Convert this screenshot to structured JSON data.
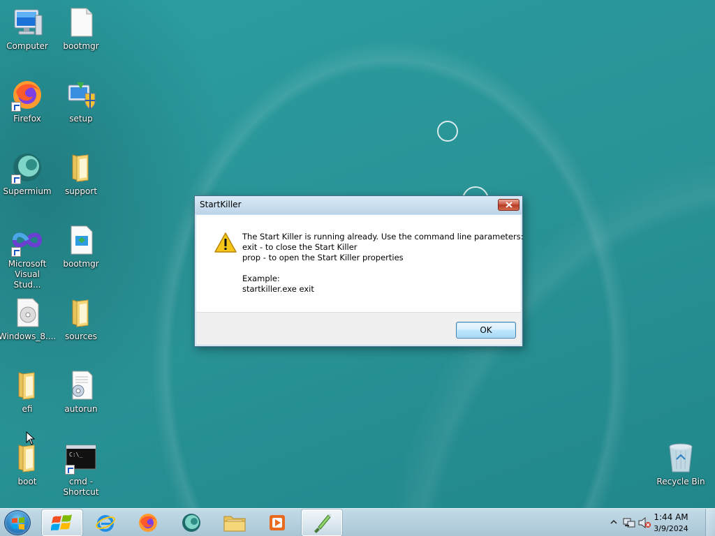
{
  "desktop": {
    "icons": [
      {
        "label": "Computer",
        "icon": "computer-icon"
      },
      {
        "label": "bootmgr",
        "icon": "file-icon"
      },
      {
        "label": "Firefox",
        "icon": "firefox-icon"
      },
      {
        "label": "setup",
        "icon": "setup-icon"
      },
      {
        "label": "Supermium",
        "icon": "supermium-icon"
      },
      {
        "label": "support",
        "icon": "folder-icon"
      },
      {
        "label": "Microsoft Visual Stud...",
        "icon": "visual-studio-icon"
      },
      {
        "label": "bootmgr",
        "icon": "efi-file-icon"
      },
      {
        "label": "Windows_8....",
        "icon": "disc-image-icon"
      },
      {
        "label": "sources",
        "icon": "folder-icon"
      },
      {
        "label": "efi",
        "icon": "folder-icon"
      },
      {
        "label": "autorun",
        "icon": "config-file-icon"
      },
      {
        "label": "boot",
        "icon": "folder-icon"
      },
      {
        "label": "cmd - Shortcut",
        "icon": "cmd-icon"
      },
      {
        "label": "Recycle Bin",
        "icon": "recycle-bin-icon"
      }
    ]
  },
  "dialog": {
    "title": "StartKiller",
    "message_lines": [
      "The Start Killer is running already. Use the command line parameters:",
      "exit - to close the Start Killer",
      "prop - to open the Start Killer properties",
      "",
      "Example:",
      "startkiller.exe exit"
    ],
    "ok_label": "OK",
    "icon": "warning-icon"
  },
  "taskbar": {
    "pinned": [
      "start-orb-icon",
      "windows-logo-icon",
      "internet-explorer-icon",
      "firefox-icon",
      "supermium-icon",
      "file-explorer-icon",
      "media-player-icon",
      "startkiller-icon"
    ],
    "clock": {
      "time": "1:44 AM",
      "date": "3/9/2024"
    },
    "tray_icons": [
      "show-hidden-icons-icon",
      "network-icon",
      "volume-muted-icon"
    ]
  },
  "colors": {
    "desktop_bg": "#2a9598",
    "taskbar_bg": "#b8d2e1",
    "dialog_frame": "#c8dff0",
    "close_button": "#c9503a"
  }
}
